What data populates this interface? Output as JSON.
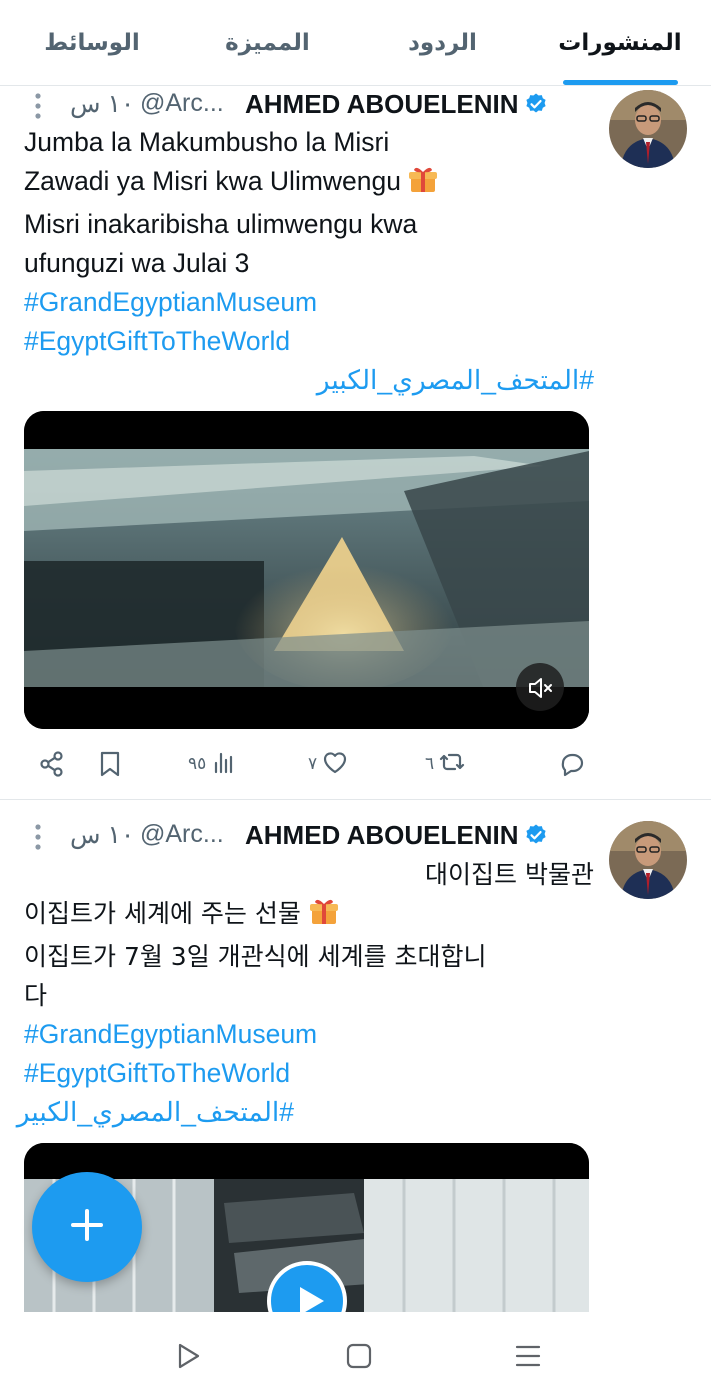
{
  "colors": {
    "accent": "#1d9bf0",
    "text": "#0f1419",
    "muted": "#536471",
    "divider": "#e3e7ea"
  },
  "tabs": [
    {
      "label": "المنشورات",
      "active": true
    },
    {
      "label": "الردود",
      "active": false
    },
    {
      "label": "المميزة",
      "active": false
    },
    {
      "label": "الوسائط",
      "active": false
    }
  ],
  "tweets": [
    {
      "name": "AHMED ABOUELENIN",
      "handle": "@Arc...",
      "time": "١٠ س",
      "verified": true,
      "lines": [
        "Jumba la Makumbusho la Misri",
        "Zawadi ya Misri kwa Ulimwengu",
        "Misri inakaribisha ulimwengu kwa",
        "ufunguzi wa Julai 3"
      ],
      "hashtags": [
        "#GrandEgyptianMuseum",
        "#EgyptGiftToTheWorld",
        "#المتحف_المصري_الكبير"
      ],
      "media": {
        "type": "video",
        "muted": true,
        "icon": "volume-mute-icon"
      },
      "actions": {
        "replies": "",
        "reposts": "٦",
        "likes": "٧",
        "views": "٩٥"
      }
    },
    {
      "name": "AHMED ABOUELENIN",
      "handle": "@Arc...",
      "time": "١٠ س",
      "verified": true,
      "lines": [
        "대이집트 박물관",
        "이집트가 세계에 주는 선물",
        "이집트가 7월 3일 개관식에 세계를 초대합니",
        "다"
      ],
      "hashtags": [
        "#GrandEgyptianMuseum",
        "#EgyptGiftToTheWorld",
        "#المتحف_المصري_الكبير"
      ],
      "media": {
        "type": "video",
        "icon": "play-icon"
      }
    }
  ],
  "fab": {
    "icon": "plus-icon"
  },
  "navbar": {
    "icons": [
      "back-triangle-icon",
      "home-square-icon",
      "recents-lines-icon"
    ]
  }
}
